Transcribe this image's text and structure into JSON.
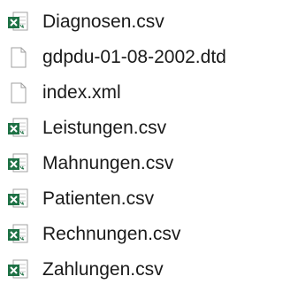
{
  "files": [
    {
      "name": "Diagnosen.csv",
      "icon": "excel-csv-icon"
    },
    {
      "name": "gdpdu-01-08-2002.dtd",
      "icon": "blank-file-icon"
    },
    {
      "name": "index.xml",
      "icon": "blank-file-icon"
    },
    {
      "name": "Leistungen.csv",
      "icon": "excel-csv-icon"
    },
    {
      "name": "Mahnungen.csv",
      "icon": "excel-csv-icon"
    },
    {
      "name": "Patienten.csv",
      "icon": "excel-csv-icon"
    },
    {
      "name": "Rechnungen.csv",
      "icon": "excel-csv-icon"
    },
    {
      "name": "Zahlungen.csv",
      "icon": "excel-csv-icon"
    }
  ],
  "colors": {
    "excel_green": "#1e7145",
    "page_border": "#a0a0a0"
  }
}
